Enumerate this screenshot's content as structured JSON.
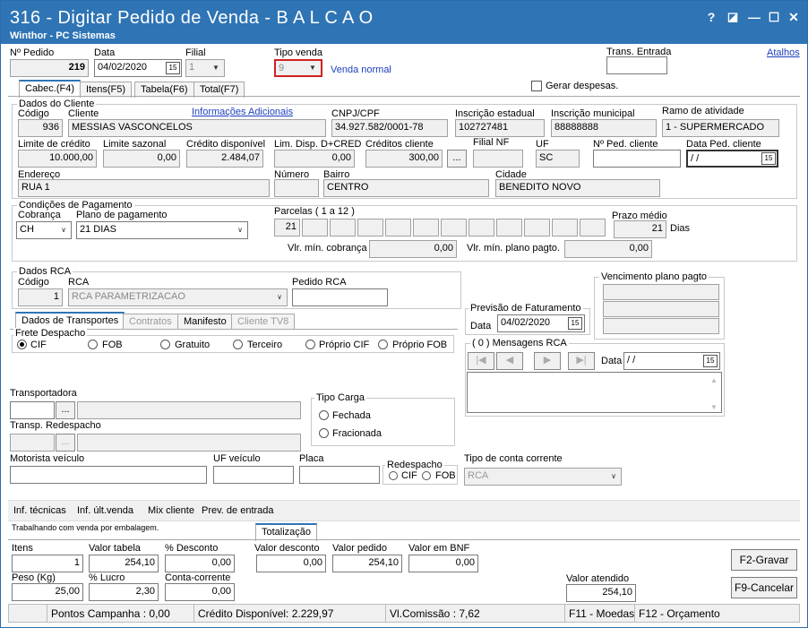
{
  "window": {
    "title": "316 - Digitar Pedido de Venda - B A L C A O",
    "subtitle": "Winthor - PC Sistemas",
    "help": "?",
    "restore": "◪",
    "minimize": "—",
    "maximize": "☐",
    "close": "✕"
  },
  "header": {
    "nro_pedido_label": "Nº Pedido",
    "nro_pedido": "219",
    "data_label": "Data",
    "data": "04/02/2020",
    "filial_label": "Filial",
    "filial": "1",
    "tipo_venda_label": "Tipo venda",
    "tipo_venda": "9",
    "tipo_venda_desc": "Venda normal",
    "trans_entrada_label": "Trans. Entrada",
    "trans_entrada": "",
    "atalhos": "Atalhos",
    "gerar_despesas": "Gerar despesas."
  },
  "tabs": [
    "Cabec.(F4)",
    "Itens(F5)",
    "Tabela(F6)",
    "Total(F7)"
  ],
  "cliente": {
    "group": "Dados do Cliente",
    "codigo_label": "Código",
    "codigo": "936",
    "cliente_label": "Cliente",
    "cliente": "MESSIAS VASCONCELOS",
    "info_adic": "Informações Adicionais",
    "cnpj_label": "CNPJ/CPF",
    "cnpj": "34.927.582/0001-78",
    "ie_label": "Inscrição estadual",
    "ie": "102727481",
    "im_label": "Inscrição municipal",
    "im": "88888888",
    "ramo_label": "Ramo de atividade",
    "ramo": "1 - SUPERMERCADO",
    "lim_credito_label": "Limite de crédito",
    "lim_credito": "10.000,00",
    "lim_sazonal_label": "Limite sazonal",
    "lim_sazonal": "0,00",
    "cred_disp_label": "Crédito disponível",
    "cred_disp": "2.484,07",
    "lim_disp_label": "Lim. Disp. D+CRED",
    "lim_disp": "0,00",
    "cred_cliente_label": "Créditos cliente",
    "cred_cliente": "300,00",
    "filial_nf_label": "Filial NF",
    "filial_nf": "",
    "uf_label": "UF",
    "uf": "SC",
    "nped_cliente_label": "Nº Ped. cliente",
    "nped_cliente": "",
    "data_ped_label": "Data Ped. cliente",
    "data_ped": "/ /",
    "endereco_label": "Endereço",
    "endereco": "RUA 1",
    "numero_label": "Número",
    "numero": "",
    "bairro_label": "Bairro",
    "bairro": "CENTRO",
    "cidade_label": "Cidade",
    "cidade": "BENEDITO NOVO",
    "ellipsis": "..."
  },
  "pagamento": {
    "group": "Condições de Pagamento",
    "cobranca_label": "Cobrança",
    "cobranca": "CH",
    "plano_label": "Plano de pagamento",
    "plano": "21 DIAS",
    "parcelas_label": "Parcelas ( 1 a 12 )",
    "parcela1": "21",
    "prazo_label": "Prazo médio",
    "prazo": "21",
    "dias": "Dias",
    "vlr_min_cob_label": "Vlr. mín. cobrança",
    "vlr_min_cob": "0,00",
    "vlr_min_plano_label": "Vlr. mín. plano pagto.",
    "vlr_min_plano": "0,00"
  },
  "rca": {
    "group": "Dados RCA",
    "codigo_label": "Código",
    "codigo": "1",
    "rca_label": "RCA",
    "rca": "RCA PARAMETRIZACAO",
    "pedido_label": "Pedido RCA",
    "pedido": ""
  },
  "vencimento": {
    "group": "Vencimento plano pagto"
  },
  "previsao": {
    "group": "Previsão de Faturamento",
    "data_label": "Data",
    "data": "04/02/2020"
  },
  "mensagens": {
    "group": "( 0 ) Mensagens RCA",
    "data_label": "Data",
    "data": "/ /",
    "first": "|◀",
    "prev": "◀",
    "next": "▶",
    "last": "▶|"
  },
  "subtabs": [
    "Dados de Transportes",
    "Contratos",
    "Manifesto",
    "Cliente TV8"
  ],
  "frete": {
    "group": "Frete Despacho",
    "options": [
      "CIF",
      "FOB",
      "Gratuito",
      "Terceiro",
      "Próprio CIF",
      "Próprio FOB"
    ]
  },
  "transporte": {
    "transportadora_label": "Transportadora",
    "redespacho_label": "Transp. Redespacho",
    "tipo_carga_group": "Tipo Carga",
    "fechada": "Fechada",
    "fracionada": "Fracionada",
    "motorista_label": "Motorista veículo",
    "uf_veiculo_label": "UF veículo",
    "placa_label": "Placa",
    "redespacho_group": "Redespacho",
    "cif": "CIF",
    "fob": "FOB",
    "tipo_cc_label": "Tipo de conta corrente",
    "tipo_cc": "RCA"
  },
  "toolbar": [
    "Inf. técnicas",
    "Inf. últ.venda",
    "Mix cliente",
    "Prev. de entrada"
  ],
  "info_line": "Trabalhando com venda por embalagem.",
  "totalizacao": {
    "tab": "Totalização",
    "itens_label": "Itens",
    "itens": "1",
    "valor_tabela_label": "Valor tabela",
    "valor_tabela": "254,10",
    "pct_desc_label": "% Desconto",
    "pct_desc": "0,00",
    "valor_desc_label": "Valor desconto",
    "valor_desc": "0,00",
    "valor_pedido_label": "Valor pedido",
    "valor_pedido": "254,10",
    "valor_bnf_label": "Valor em BNF",
    "valor_bnf": "0,00",
    "peso_label": "Peso (Kg)",
    "peso": "25,00",
    "pct_lucro_label": "% Lucro",
    "pct_lucro": "2,30",
    "conta_corrente_label": "Conta-corrente",
    "conta_corrente": "0,00",
    "valor_atendido_label": "Valor atendido",
    "valor_atendido": "254,10"
  },
  "buttons": {
    "gravar": "F2-Gravar",
    "cancelar": "F9-Cancelar"
  },
  "statusbar": {
    "pontos": "Pontos Campanha : 0,00",
    "credito": "Crédito Disponível: 2.229,97",
    "comissao": "Vl.Comissão : 7,62",
    "f11": "F11 - Moedas",
    "f12": "F12 - Orçamento"
  }
}
